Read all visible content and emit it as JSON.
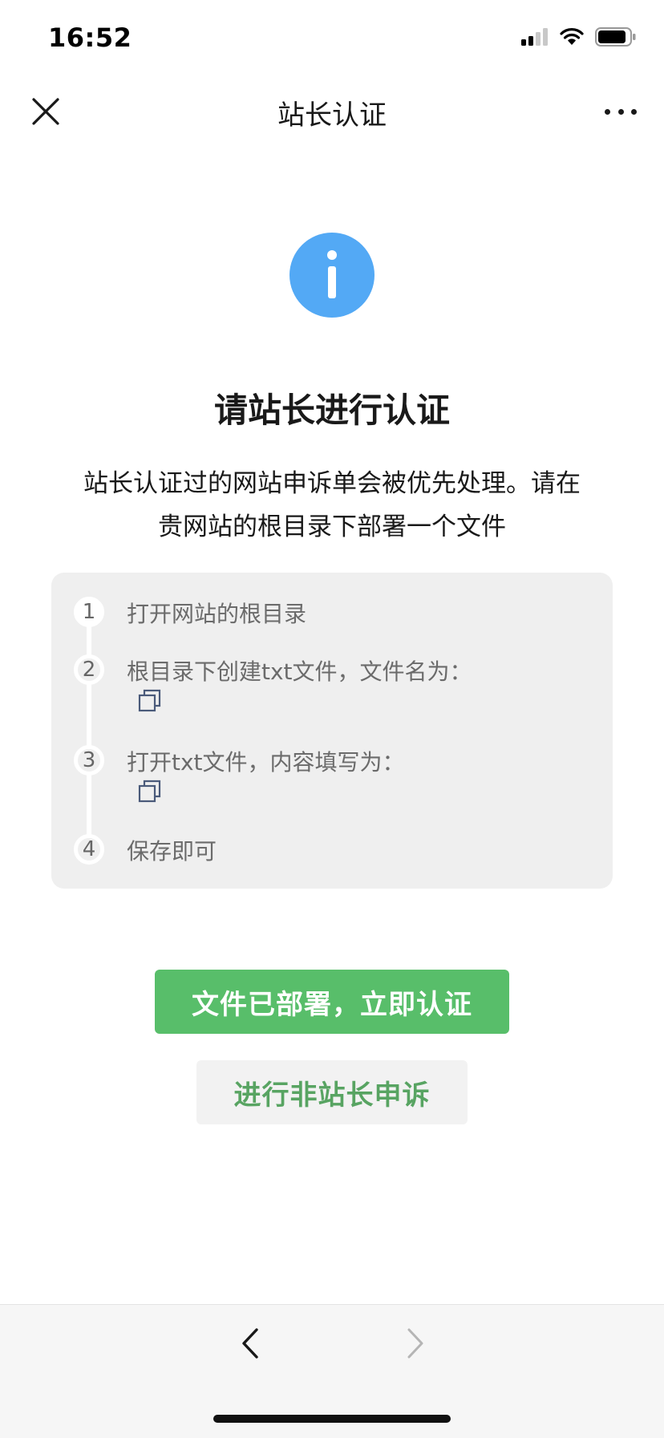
{
  "status_bar": {
    "time": "16:52",
    "icons": [
      "signal-icon",
      "wifi-icon",
      "battery-icon"
    ]
  },
  "nav": {
    "title": "站长认证",
    "close_icon": "close-icon",
    "more_icon": "more-icon"
  },
  "main": {
    "icon": "info-icon",
    "headline": "请站长进行认证",
    "description_line1": "站长认证过的网站申诉单会被优先处理。请在",
    "description_line2": "贵网站的根目录下部署一个文件",
    "steps": [
      {
        "number": "1",
        "text": "打开网站的根目录"
      },
      {
        "number": "2",
        "text": "根目录下创建txt文件，文件名为："
      },
      {
        "number": "3",
        "text": "打开txt文件，内容填写为："
      },
      {
        "number": "4",
        "text": "保存即可"
      }
    ]
  },
  "actions": {
    "primary_label": "文件已部署，立即认证",
    "secondary_label": "进行非站长申诉"
  },
  "toolbar": {
    "back_icon": "chevron-left-icon",
    "forward_icon": "chevron-right-icon"
  },
  "colors": {
    "accent_green": "#58be6a",
    "info_blue": "#53a9f5",
    "card_bg": "#efefef"
  }
}
